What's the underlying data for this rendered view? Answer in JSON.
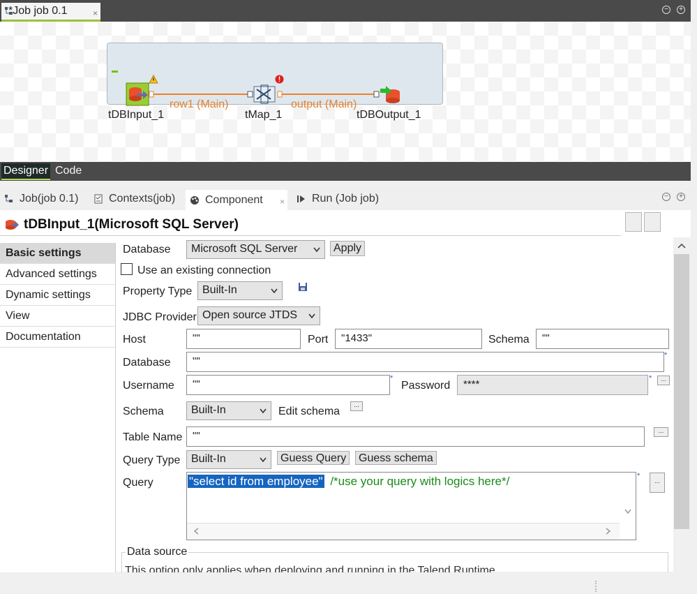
{
  "editor": {
    "tab_title": "*Job job 0.1",
    "close_glyph": "×",
    "bottom_tabs": [
      "Designer",
      "Code"
    ]
  },
  "canvas": {
    "components": [
      {
        "name": "tDBInput_1",
        "icon": "db-input-icon",
        "badge": "warning"
      },
      {
        "name": "tMap_1",
        "icon": "tmap-icon",
        "badge": "error"
      },
      {
        "name": "tDBOutput_1",
        "icon": "db-output-icon"
      }
    ],
    "links": [
      {
        "label": "row1 (Main)"
      },
      {
        "label": "output (Main)"
      }
    ],
    "link_color": "#e8822c"
  },
  "view_tabs": [
    {
      "label": "Job(job 0.1)",
      "icon": "job-icon"
    },
    {
      "label": "Contexts(job)",
      "icon": "contexts-icon"
    },
    {
      "label": "Component",
      "icon": "palette-icon",
      "active": true
    },
    {
      "label": "Run (Job job)",
      "icon": "run-icon"
    }
  ],
  "component": {
    "title": "tDBInput_1(Microsoft SQL Server)"
  },
  "nav": [
    {
      "label": "Basic settings",
      "selected": true
    },
    {
      "label": "Advanced settings"
    },
    {
      "label": "Dynamic settings"
    },
    {
      "label": "View"
    },
    {
      "label": "Documentation"
    }
  ],
  "form": {
    "database_label": "Database",
    "database_value": "Microsoft SQL Server",
    "apply_label": "Apply",
    "existing_conn_label": "Use an existing connection",
    "property_type_label": "Property Type",
    "property_type_value": "Built-In",
    "jdbc_label": "JDBC Provider",
    "jdbc_value": "Open source JTDS",
    "host_label": "Host",
    "host_value": "\"\"",
    "port_label": "Port",
    "port_value": "\"1433\"",
    "schema_label": "Schema",
    "schema_value": "\"\"",
    "db_label": "Database",
    "db_value": "\"\"",
    "username_label": "Username",
    "username_value": "\"\"",
    "password_label": "Password",
    "password_value": "****",
    "schema2_label": "Schema",
    "schema2_value": "Built-In",
    "edit_schema_label": "Edit schema",
    "table_label": "Table Name",
    "table_value": "\"\"",
    "query_type_label": "Query Type",
    "query_type_value": "Built-In",
    "guess_query_label": "Guess Query",
    "guess_schema_label": "Guess schema",
    "query_label": "Query",
    "query_string": "\"select id from employee\"",
    "query_comment": "/*use your query with logics here*/",
    "required_mark": "*",
    "dots_glyph": "...",
    "data_source_label": "Data source",
    "data_source_text": "This option only applies when deploying and running in the Talend Runtime"
  }
}
